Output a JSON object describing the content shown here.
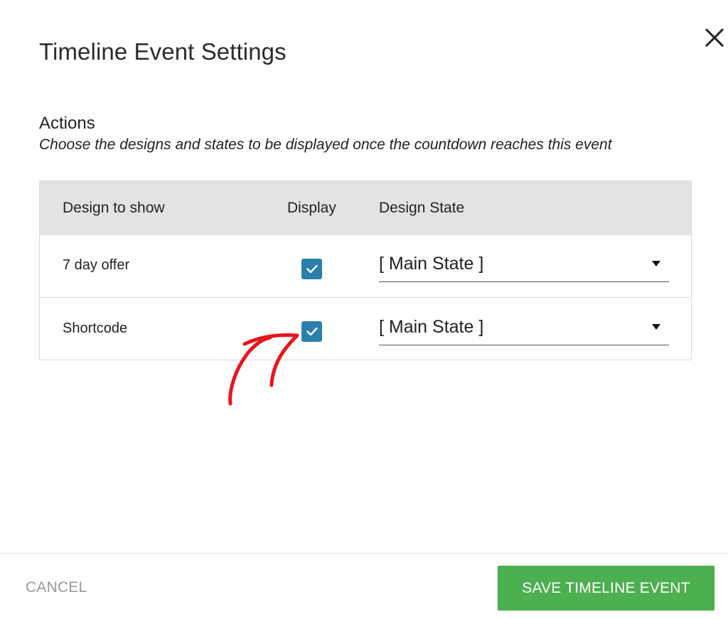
{
  "dialog": {
    "title": "Timeline Event Settings"
  },
  "actions": {
    "heading": "Actions",
    "description": "Choose the designs and states to be displayed once the countdown reaches this event"
  },
  "table": {
    "headers": {
      "design": "Design to show",
      "display": "Display",
      "state": "Design State"
    },
    "rows": [
      {
        "design": "7 day offer",
        "display": true,
        "state": "[ Main State ]"
      },
      {
        "design": "Shortcode",
        "display": true,
        "state": "[ Main State ]"
      }
    ]
  },
  "footer": {
    "cancel_label": "CANCEL",
    "save_label": "SAVE TIMELINE EVENT"
  },
  "colors": {
    "checkbox": "#2a7fae",
    "save_button": "#4caf50",
    "header_bg": "#e3e3e3",
    "annotation": "#e8141c"
  },
  "icons": {
    "close": "close-icon",
    "check": "checkmark-icon",
    "caret": "caret-down-icon",
    "annotation": "hand-drawn-arrow-icon"
  }
}
